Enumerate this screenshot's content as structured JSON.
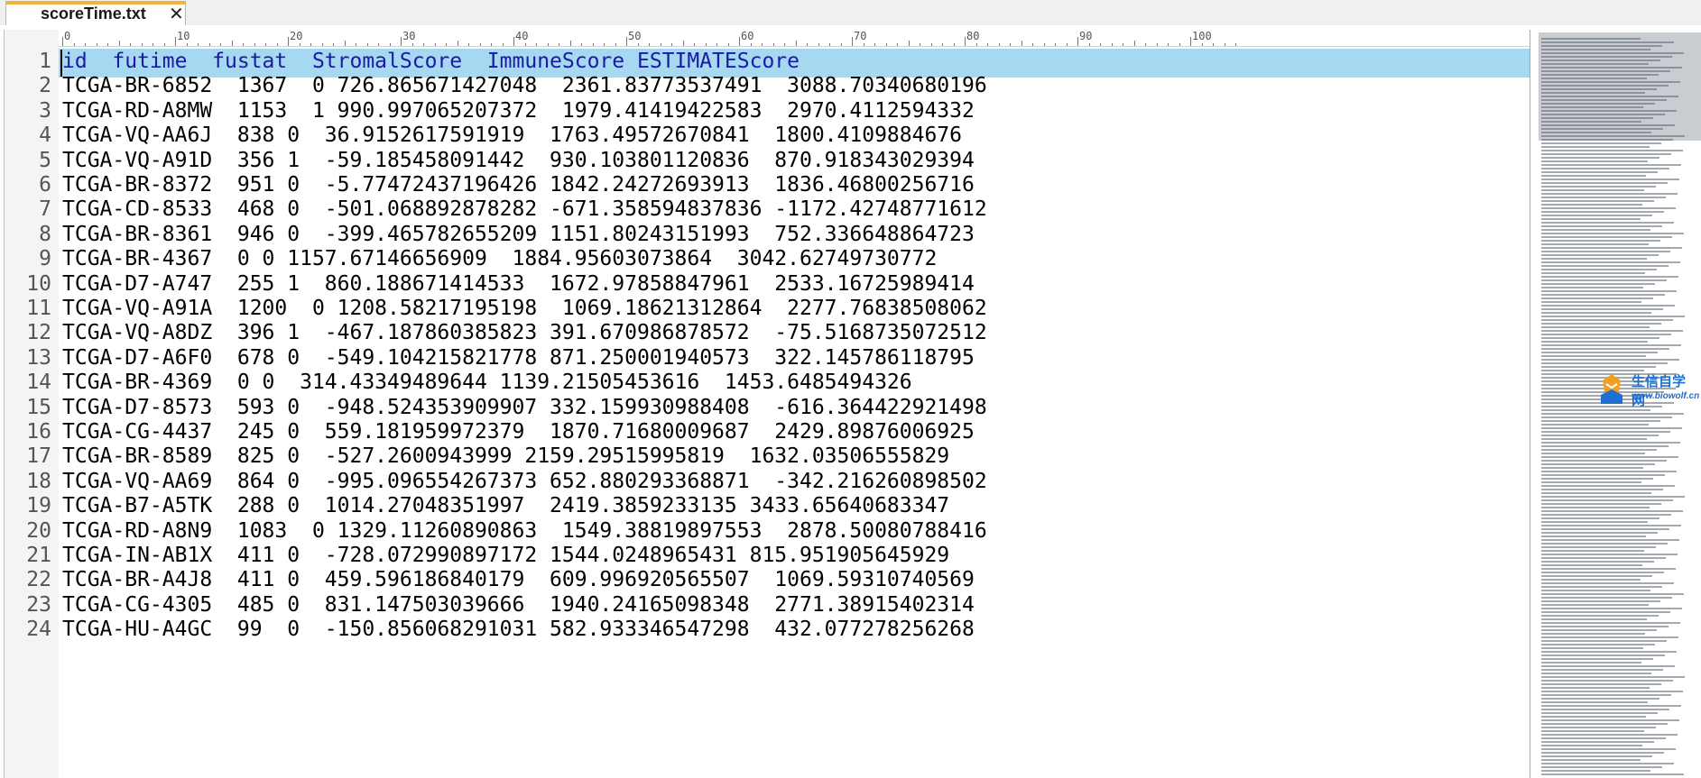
{
  "tab": {
    "title": "scoreTime.txt",
    "close_glyph": "✕"
  },
  "ruler": {
    "labels": [
      "0",
      "10",
      "20",
      "30",
      "40",
      "50",
      "60",
      "70",
      "80",
      "90",
      "100"
    ]
  },
  "editor": {
    "highlighted_line": 1,
    "lines": [
      "id  futime  fustat  StromalScore  ImmuneScore ESTIMATEScore",
      "TCGA-BR-6852  1367  0 726.865671427048  2361.83773537491  3088.70340680196",
      "TCGA-RD-A8MW  1153  1 990.997065207372  1979.41419422583  2970.4112594332",
      "TCGA-VQ-AA6J  838 0  36.9152617591919  1763.49572670841  1800.4109884676",
      "TCGA-VQ-A91D  356 1  -59.185458091442  930.103801120836  870.918343029394",
      "TCGA-BR-8372  951 0  -5.77472437196426 1842.24272693913  1836.46800256716",
      "TCGA-CD-8533  468 0  -501.068892878282 -671.358594837836 -1172.42748771612",
      "TCGA-BR-8361  946 0  -399.465782655209 1151.80243151993  752.336648864723",
      "TCGA-BR-4367  0 0 1157.67146656909  1884.95603073864  3042.62749730772",
      "TCGA-D7-A747  255 1  860.188671414533  1672.97858847961  2533.16725989414",
      "TCGA-VQ-A91A  1200  0 1208.58217195198  1069.18621312864  2277.76838508062",
      "TCGA-VQ-A8DZ  396 1  -467.187860385823 391.670986878572  -75.5168735072512",
      "TCGA-D7-A6F0  678 0  -549.104215821778 871.250001940573  322.145786118795",
      "TCGA-BR-4369  0 0  314.43349489644 1139.21505453616  1453.6485494326",
      "TCGA-D7-8573  593 0  -948.524353909907 332.159930988408  -616.364422921498",
      "TCGA-CG-4437  245 0  559.181959972379  1870.71680009687  2429.89876006925",
      "TCGA-BR-8589  825 0  -527.2600943999 2159.29515995819  1632.03506555829",
      "TCGA-VQ-AA69  864 0  -995.096554267373 652.880293368871  -342.216260898502",
      "TCGA-B7-A5TK  288 0  1014.27048351997  2419.3859233135 3433.65640683347",
      "TCGA-RD-A8N9  1083  0 1329.11260890863  1549.38819897553  2878.50080788416",
      "TCGA-IN-AB1X  411 0  -728.072990897172 1544.0248965431 815.951905645929",
      "TCGA-BR-A4J8  411 0  459.596186840179  609.996920565507  1069.59310740569",
      "TCGA-CG-4305  485 0  831.147503039666  1940.24165098348  2771.38915402314",
      "TCGA-HU-A4GC  99  0  -150.856068291031 582.933346547298  432.077278256268"
    ]
  },
  "watermark": {
    "title": "生信自学网",
    "url": "www.biowolf.cn"
  },
  "colors": {
    "line_highlight": "#a6d8f0",
    "header_text": "#1a1aa6",
    "tab_accent": "#f4b33e"
  }
}
